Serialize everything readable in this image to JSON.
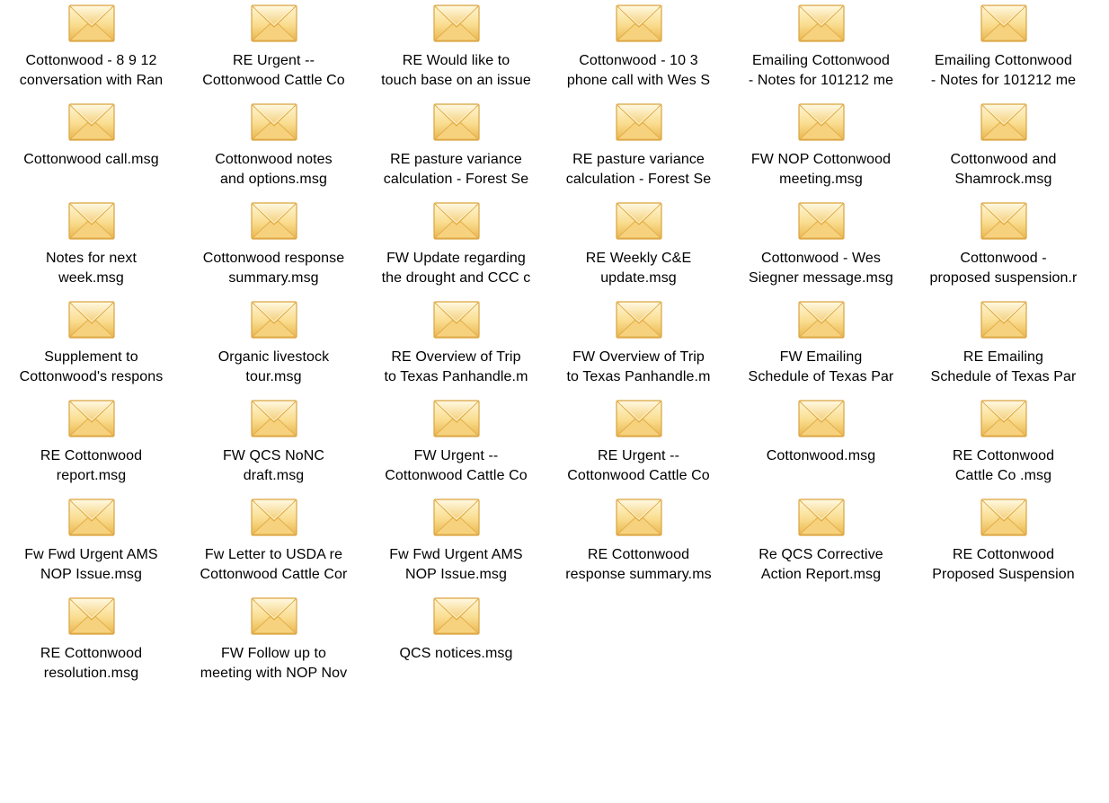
{
  "icon": "envelope-msg-icon",
  "colors": {
    "envelope_light": "#fff2c4",
    "envelope_mid": "#f6d27a",
    "envelope_dark": "#e0a838",
    "background": "#ffffff",
    "text": "#000000"
  },
  "files": [
    {
      "line1": "Cottonwood - 8 9 12",
      "line2": "conversation with Ran"
    },
    {
      "line1": "RE  Urgent --",
      "line2": "Cottonwood Cattle Co"
    },
    {
      "line1": "RE  Would like to",
      "line2": "touch base on an issue"
    },
    {
      "line1": "Cottonwood - 10 3",
      "line2": "phone call with Wes S"
    },
    {
      "line1": "Emailing  Cottonwood",
      "line2": "- Notes for 101212 me"
    },
    {
      "line1": "Emailing  Cottonwood",
      "line2": "- Notes for 101212 me"
    },
    {
      "line1": "Cottonwood call.msg",
      "line2": ""
    },
    {
      "line1": "Cottonwood notes",
      "line2": "and options.msg"
    },
    {
      "line1": "RE  pasture variance",
      "line2": "calculation - Forest Se"
    },
    {
      "line1": "RE  pasture variance",
      "line2": "calculation - Forest Se"
    },
    {
      "line1": "FW  NOP Cottonwood",
      "line2": "meeting.msg"
    },
    {
      "line1": "Cottonwood and",
      "line2": "Shamrock.msg"
    },
    {
      "line1": "Notes for next",
      "line2": "week.msg"
    },
    {
      "line1": "Cottonwood response",
      "line2": "summary.msg"
    },
    {
      "line1": "FW  Update regarding",
      "line2": "the drought and CCC c"
    },
    {
      "line1": "RE  Weekly C&E",
      "line2": "update.msg"
    },
    {
      "line1": "Cottonwood - Wes",
      "line2": "Siegner message.msg"
    },
    {
      "line1": "Cottonwood -",
      "line2": "proposed suspension.r"
    },
    {
      "line1": "Supplement to",
      "line2": "Cottonwood's respons"
    },
    {
      "line1": "Organic livestock",
      "line2": "tour.msg"
    },
    {
      "line1": "RE  Overview of Trip",
      "line2": "to Texas Panhandle.m"
    },
    {
      "line1": "FW  Overview of Trip",
      "line2": "to Texas Panhandle.m"
    },
    {
      "line1": "FW  Emailing",
      "line2": "Schedule of Texas Par"
    },
    {
      "line1": "RE  Emailing",
      "line2": "Schedule of Texas Par"
    },
    {
      "line1": "RE  Cottonwood",
      "line2": "report.msg"
    },
    {
      "line1": "FW  QCS NoNC",
      "line2": "draft.msg"
    },
    {
      "line1": "FW  Urgent --",
      "line2": "Cottonwood Cattle Co"
    },
    {
      "line1": "RE  Urgent --",
      "line2": "Cottonwood Cattle Co"
    },
    {
      "line1": "Cottonwood.msg",
      "line2": ""
    },
    {
      "line1": "RE  Cottonwood",
      "line2": "Cattle Co .msg"
    },
    {
      "line1": "Fw  Fwd  Urgent AMS",
      "line2": "NOP Issue.msg"
    },
    {
      "line1": "Fw  Letter to USDA re",
      "line2": "Cottonwood Cattle Cor"
    },
    {
      "line1": "Fw  Fwd  Urgent AMS",
      "line2": "NOP Issue.msg"
    },
    {
      "line1": "RE  Cottonwood",
      "line2": "response summary.ms"
    },
    {
      "line1": "Re  QCS Corrective",
      "line2": "Action Report.msg"
    },
    {
      "line1": "RE  Cottonwood",
      "line2": "Proposed Suspension"
    },
    {
      "line1": "RE  Cottonwood",
      "line2": "resolution.msg"
    },
    {
      "line1": "FW  Follow up to",
      "line2": "meeting with NOP Nov"
    },
    {
      "line1": "QCS notices.msg",
      "line2": ""
    }
  ]
}
